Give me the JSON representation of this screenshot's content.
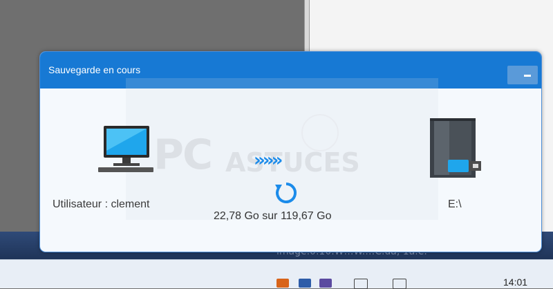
{
  "dialog": {
    "title": "Sauvegarde en cours",
    "source_label": "Utilisateur : clement",
    "destination_label": "E:\\",
    "progress_text": "22,78 Go sur 119,67 Go",
    "icons": [
      "computer-icon",
      "transfer-arrows-icon",
      "sync-icon",
      "external-drive-icon",
      "minimize-icon"
    ],
    "accent_color": "#1779d4"
  },
  "background": {
    "watermark": "PC ASTUCES",
    "taskbar_clock": "14:01"
  }
}
